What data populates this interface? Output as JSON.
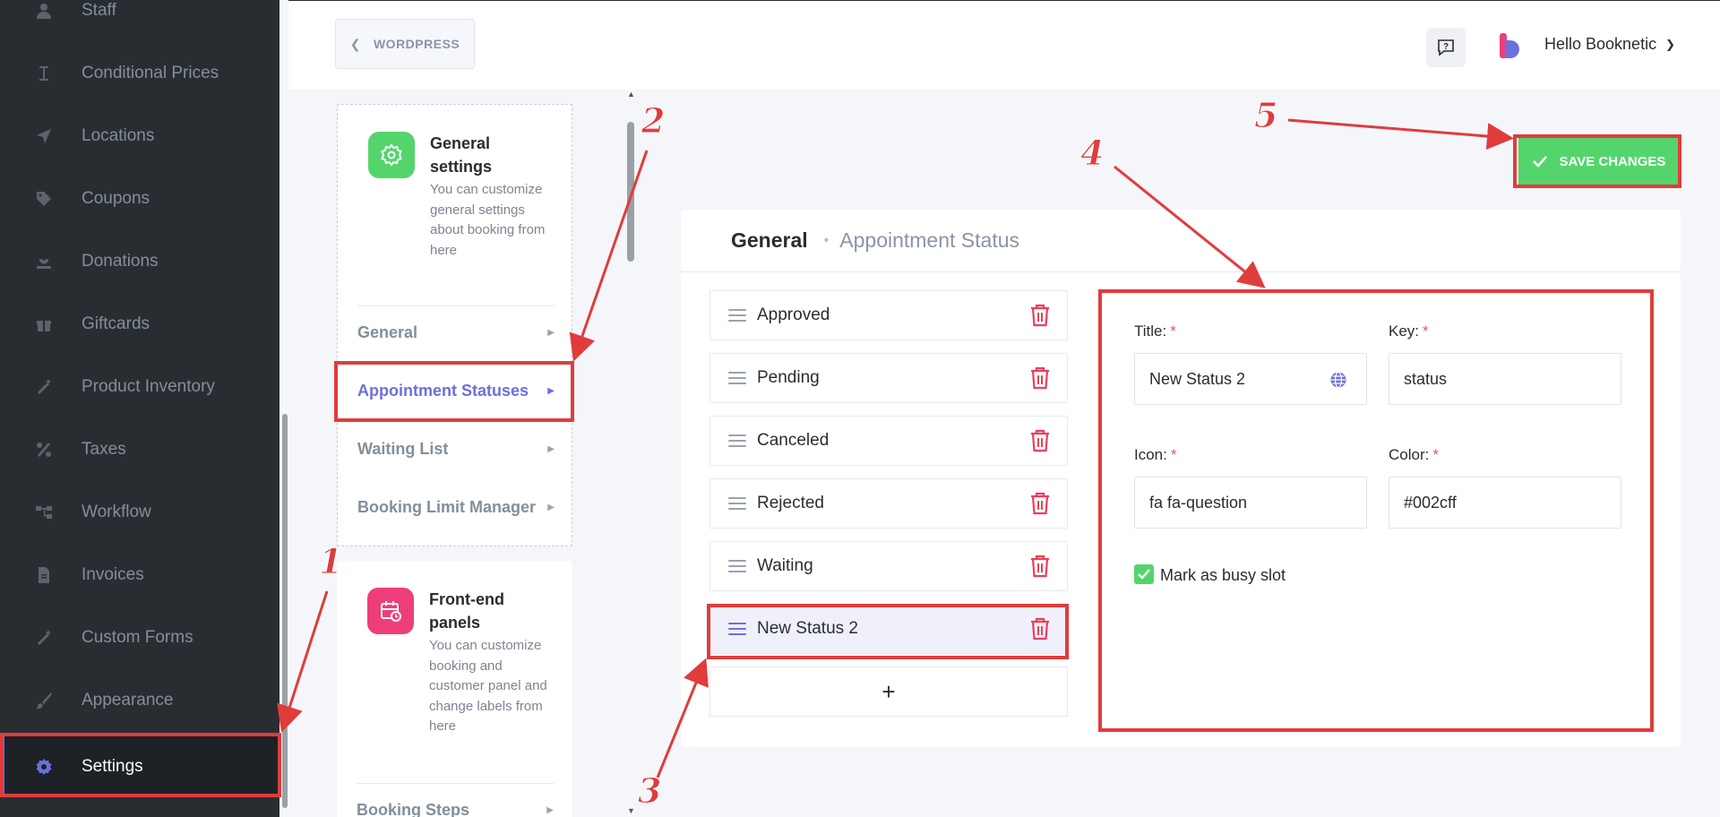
{
  "sidebar": {
    "items": [
      {
        "label": "Staff",
        "icon": "user-icon"
      },
      {
        "label": "Conditional Prices",
        "icon": "cursor-text-icon"
      },
      {
        "label": "Locations",
        "icon": "location-arrow-icon"
      },
      {
        "label": "Coupons",
        "icon": "tag-icon"
      },
      {
        "label": "Donations",
        "icon": "hand-heart-icon"
      },
      {
        "label": "Giftcards",
        "icon": "gift-icon"
      },
      {
        "label": "Product Inventory",
        "icon": "magic-wand-icon"
      },
      {
        "label": "Taxes",
        "icon": "percent-icon"
      },
      {
        "label": "Workflow",
        "icon": "workflow-icon"
      },
      {
        "label": "Invoices",
        "icon": "document-icon"
      },
      {
        "label": "Custom Forms",
        "icon": "magic-wand-icon"
      },
      {
        "label": "Appearance",
        "icon": "brush-icon"
      },
      {
        "label": "Settings",
        "icon": "gear-icon"
      }
    ],
    "active": "Settings"
  },
  "header": {
    "back_label": "WORDPRESS",
    "greeting": "Hello Booknetic"
  },
  "settings_menu": {
    "general": {
      "title": "General settings",
      "description": "You can customize general settings about booking from here",
      "links": [
        "General",
        "Appointment Statuses",
        "Waiting List",
        "Booking Limit Manager"
      ],
      "active_link": "Appointment Statuses"
    },
    "frontend": {
      "title": "Front-end panels",
      "description": "You can customize booking and customer panel and change labels from here",
      "links": [
        "Booking Steps"
      ]
    }
  },
  "main": {
    "breadcrumb": {
      "root": "General",
      "current": "Appointment Status"
    },
    "save_label": "SAVE CHANGES",
    "statuses": [
      "Approved",
      "Pending",
      "Canceled",
      "Rejected",
      "Waiting",
      "New Status 2"
    ],
    "selected_status": "New Status 2",
    "add_label": "+",
    "form": {
      "title_label": "Title:",
      "title_value": "New Status 2",
      "key_label": "Key:",
      "key_value": "status",
      "icon_label": "Icon:",
      "icon_value": "fa fa-question",
      "color_label": "Color:",
      "color_value": "#002cff",
      "busy_label": "Mark as busy slot",
      "busy_checked": true,
      "required_mark": "*"
    }
  },
  "annotations": [
    "1",
    "2",
    "3",
    "4",
    "5"
  ],
  "colors": {
    "accent": "#6c70dc",
    "save_green": "#53d56c",
    "annotation_red": "#e03c3c",
    "trash_red": "#ee3e5a",
    "sidebar_bg": "#292d32"
  }
}
